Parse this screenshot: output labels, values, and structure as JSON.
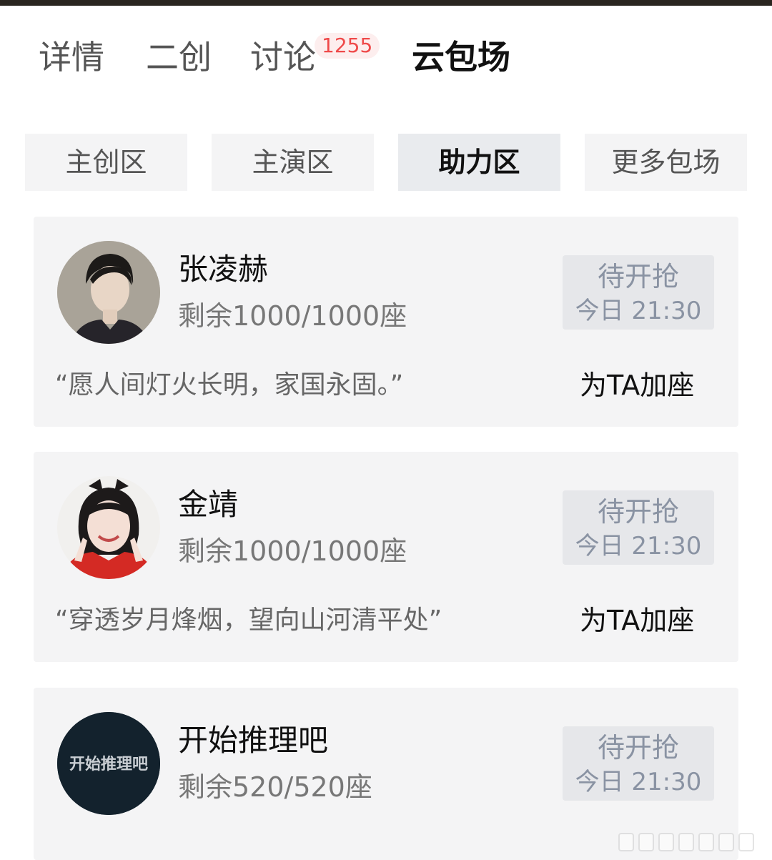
{
  "tabs": [
    {
      "label": "详情",
      "active": false
    },
    {
      "label": "二创",
      "active": false
    },
    {
      "label": "讨论",
      "active": false,
      "badge": "1255"
    },
    {
      "label": "云包场",
      "active": true
    }
  ],
  "segments": [
    {
      "label": "主创区",
      "active": false
    },
    {
      "label": "主演区",
      "active": false
    },
    {
      "label": "助力区",
      "active": true
    },
    {
      "label": "更多包场",
      "active": false
    }
  ],
  "cards": [
    {
      "name": "张凌赫",
      "seats": "剩余1000/1000座",
      "status": "待开抢",
      "time": "今日 21:30",
      "quote": "“愿人间灯火长明，家国永固。”",
      "action": "为TA加座"
    },
    {
      "name": "金靖",
      "seats": "剩余1000/1000座",
      "status": "待开抢",
      "time": "今日 21:30",
      "quote": "“穿透岁月烽烟，望向山河清平处”",
      "action": "为TA加座"
    },
    {
      "name": "开始推理吧",
      "seats": "剩余520/520座",
      "status": "待开抢",
      "time": "今日 21:30",
      "avatar_text": "开始推理吧"
    }
  ],
  "colors": {
    "card_bg": "#f4f4f5",
    "status_text": "#8a93a3",
    "badge_text": "#ef4a4a",
    "top_bar": "#2a2620"
  }
}
